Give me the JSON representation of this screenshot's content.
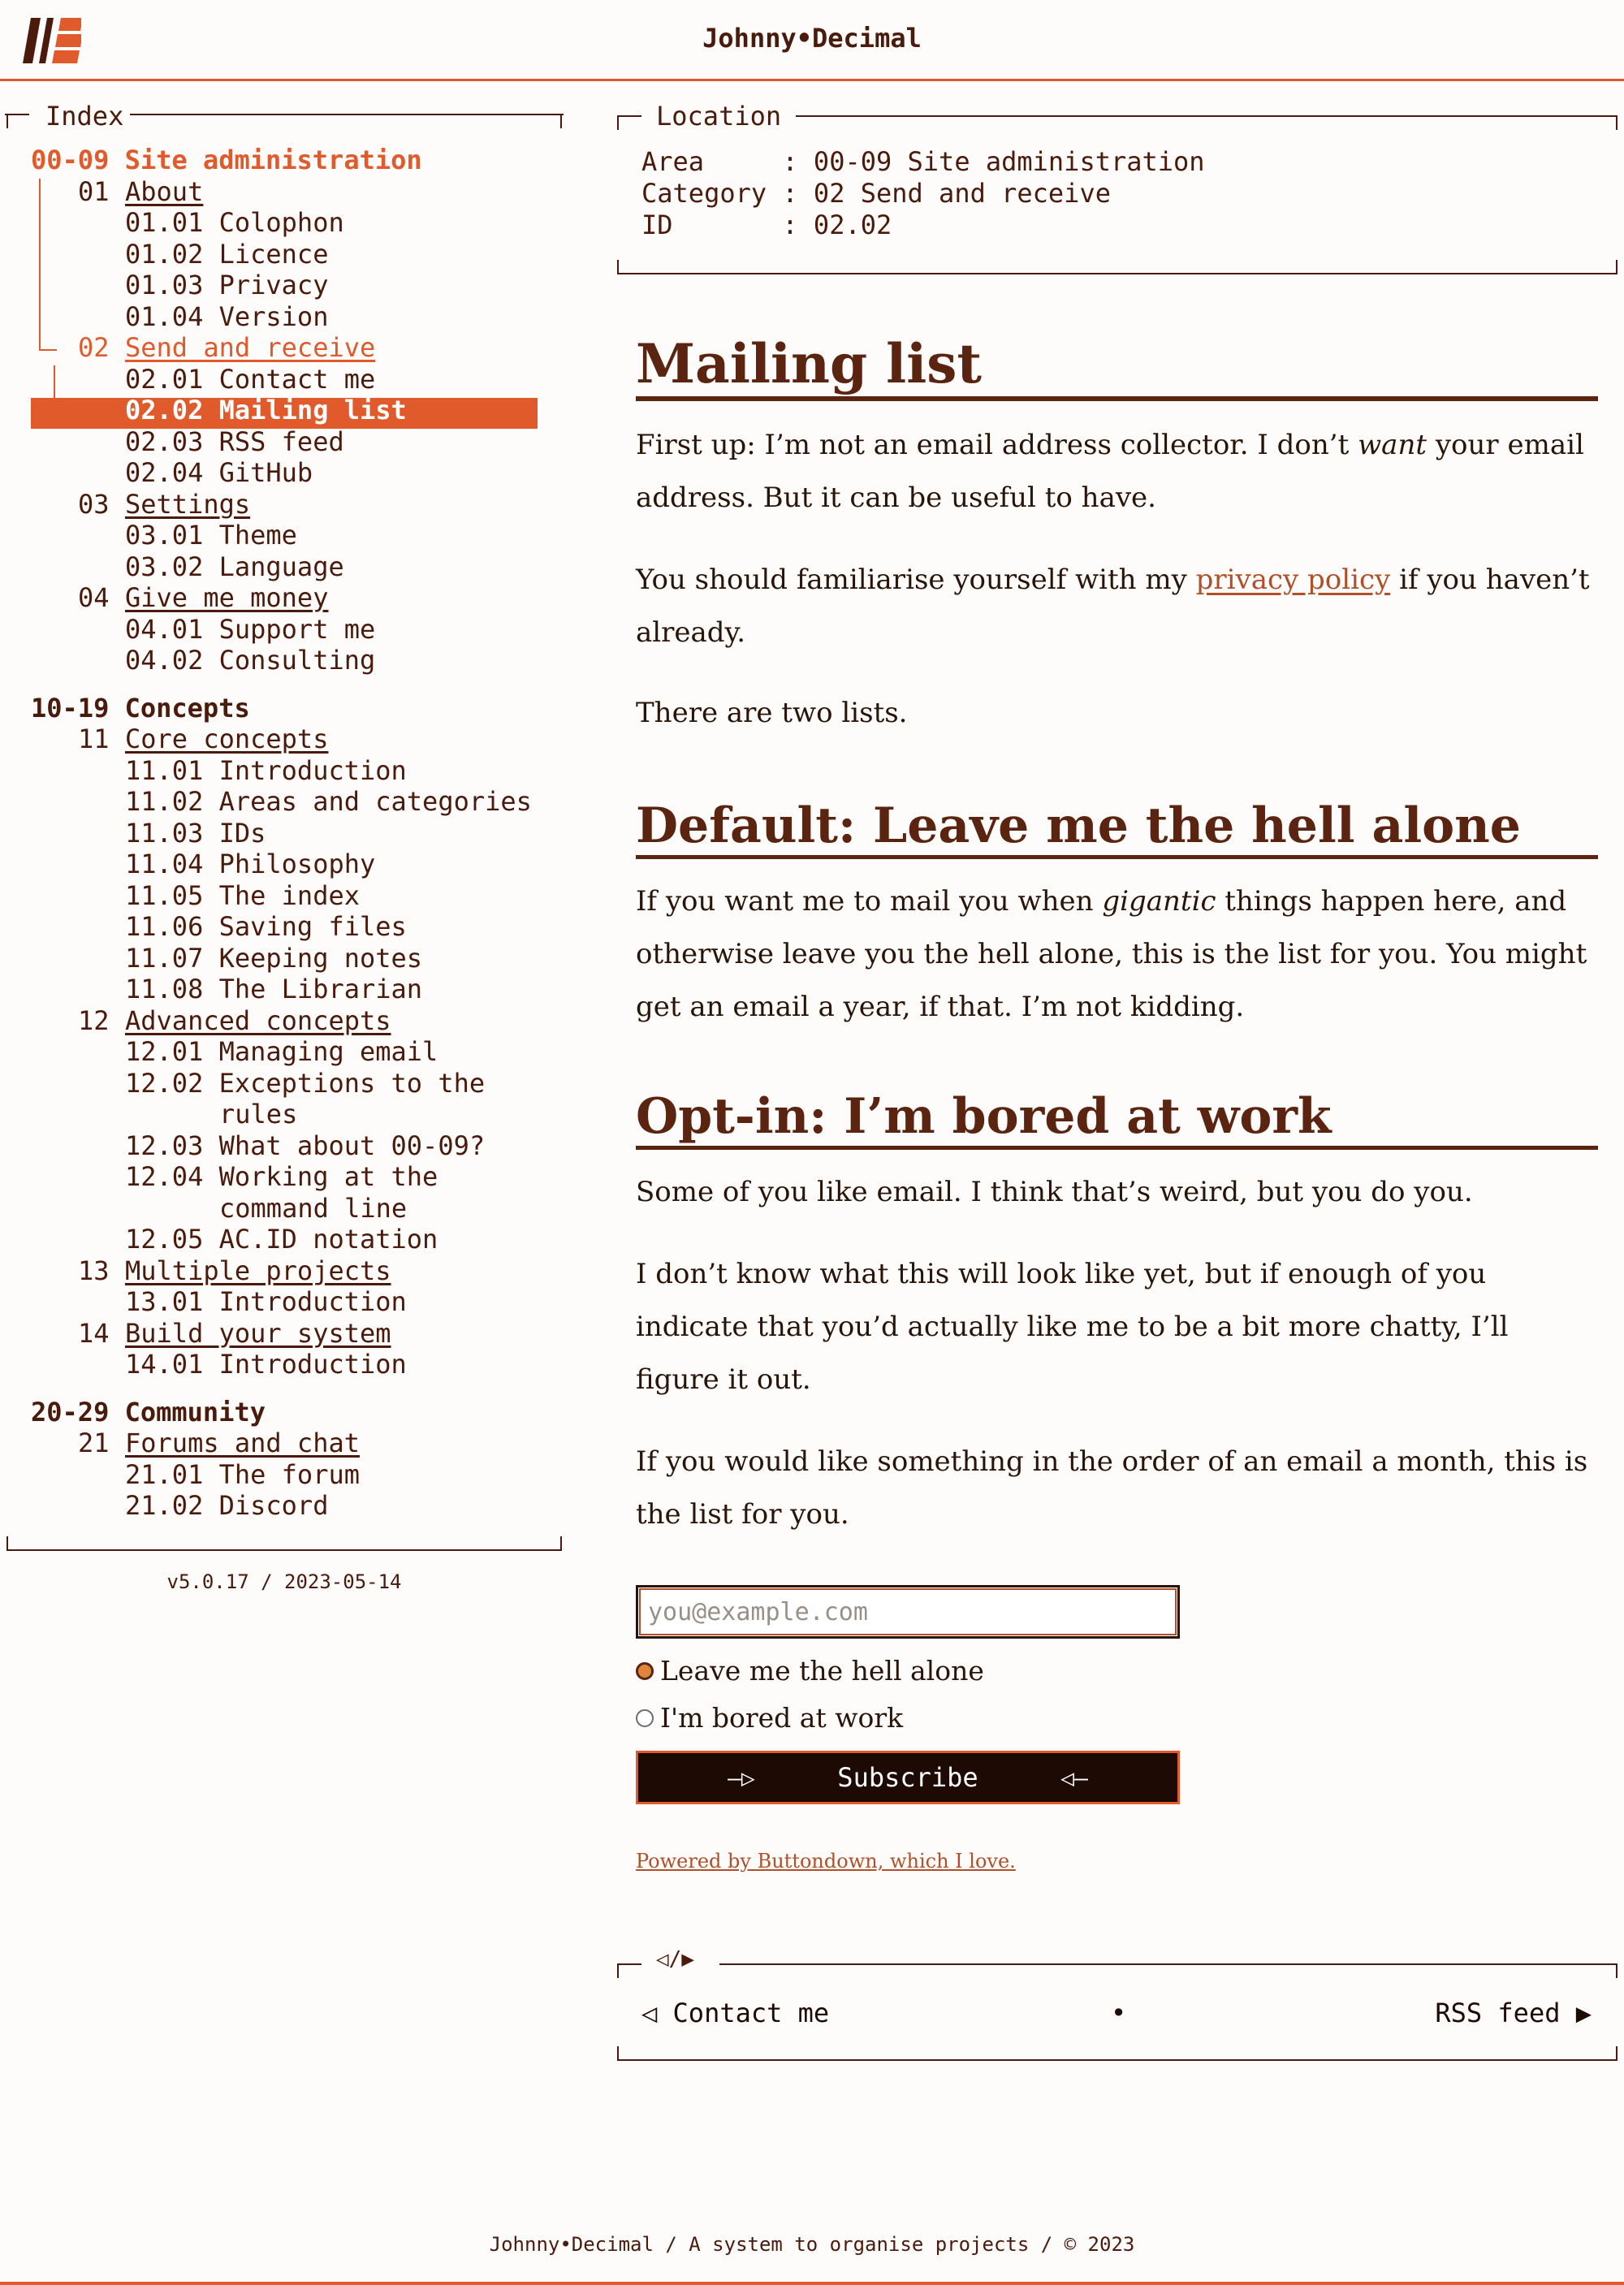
{
  "header": {
    "site_title": "Johnny•Decimal"
  },
  "index": {
    "legend": "Index",
    "rows": [
      {
        "type": "area",
        "num": "00-09",
        "label": "Site administration",
        "active": true
      },
      {
        "type": "cat",
        "num": "01",
        "label": "About"
      },
      {
        "type": "id",
        "text": "01.01 Colophon"
      },
      {
        "type": "id",
        "text": "01.02 Licence"
      },
      {
        "type": "id",
        "text": "01.03 Privacy"
      },
      {
        "type": "id",
        "text": "01.04 Version"
      },
      {
        "type": "cat",
        "num": "02",
        "label": "Send and receive",
        "active": true
      },
      {
        "type": "id",
        "text": "02.01 Contact me"
      },
      {
        "type": "id",
        "text": "02.02 Mailing list",
        "selected": true
      },
      {
        "type": "id",
        "text": "02.03 RSS feed"
      },
      {
        "type": "id",
        "text": "02.04 GitHub"
      },
      {
        "type": "cat",
        "num": "03",
        "label": "Settings"
      },
      {
        "type": "id",
        "text": "03.01 Theme"
      },
      {
        "type": "id",
        "text": "03.02 Language"
      },
      {
        "type": "cat",
        "num": "04",
        "label": "Give me money"
      },
      {
        "type": "id",
        "text": "04.01 Support me"
      },
      {
        "type": "id",
        "text": "04.02 Consulting"
      },
      {
        "type": "gap"
      },
      {
        "type": "area",
        "num": "10-19",
        "label": "Concepts"
      },
      {
        "type": "cat",
        "num": "11",
        "label": "Core concepts"
      },
      {
        "type": "id",
        "text": "11.01 Introduction"
      },
      {
        "type": "id",
        "text": "11.02 Areas and categories"
      },
      {
        "type": "id",
        "text": "11.03 IDs"
      },
      {
        "type": "id",
        "text": "11.04 Philosophy"
      },
      {
        "type": "id",
        "text": "11.05 The index"
      },
      {
        "type": "id",
        "text": "11.06 Saving files"
      },
      {
        "type": "id",
        "text": "11.07 Keeping notes"
      },
      {
        "type": "id",
        "text": "11.08 The Librarian"
      },
      {
        "type": "cat",
        "num": "12",
        "label": "Advanced concepts"
      },
      {
        "type": "id",
        "text": "12.01 Managing email"
      },
      {
        "type": "id",
        "text": "12.02 Exceptions to the"
      },
      {
        "type": "wrap",
        "text": "rules"
      },
      {
        "type": "id",
        "text": "12.03 What about 00-09?"
      },
      {
        "type": "id",
        "text": "12.04 Working at the"
      },
      {
        "type": "wrap",
        "text": "command line"
      },
      {
        "type": "id",
        "text": "12.05 AC.ID notation"
      },
      {
        "type": "cat",
        "num": "13",
        "label": "Multiple projects"
      },
      {
        "type": "id",
        "text": "13.01 Introduction"
      },
      {
        "type": "cat",
        "num": "14",
        "label": "Build your system"
      },
      {
        "type": "id",
        "text": "14.01 Introduction"
      },
      {
        "type": "gap"
      },
      {
        "type": "area",
        "num": "20-29",
        "label": "Community"
      },
      {
        "type": "cat",
        "num": "21",
        "label": "Forums and chat"
      },
      {
        "type": "id",
        "text": "21.01 The forum"
      },
      {
        "type": "id",
        "text": "21.02 Discord"
      }
    ],
    "version": "v5.0.17 / 2023-05-14"
  },
  "location": {
    "legend": "Location",
    "area": "Area     : 00-09 Site administration",
    "category": "Category : 02 Send and receive",
    "id": "ID       : 02.02"
  },
  "article": {
    "title": "Mailing list",
    "p1_a": "First up: I’m not an email address collector. I don’t ",
    "p1_em": "want",
    "p1_b": " your email address. But it can be useful to have.",
    "p2_a": "You should familiarise yourself with my ",
    "p2_link": "privacy policy",
    "p2_b": " if you haven’t already.",
    "p3": "There are two lists.",
    "h2_default": "Default: Leave me the hell alone",
    "p4_a": "If you want me to mail you when ",
    "p4_em": "gigantic",
    "p4_b": " things happen here, and otherwise leave you the hell alone, this is the list for you. You might get an email a year, if that. I’m not kidding.",
    "h2_optin": "Opt-in: I’m bored at work",
    "p5": "Some of you like email. I think that’s weird, but you do you.",
    "p6": "I don’t know what this will look like yet, but if enough of you indicate that you’d actually like me to be a bit more chatty, I’ll figure it out.",
    "p7": "If you would like something in the order of an email a month, this is the list for you."
  },
  "form": {
    "email_placeholder": "you@example.com",
    "radio_1": "Leave me the hell alone",
    "radio_2": "I'm bored at work",
    "radio_selected": "Leave me the hell alone",
    "subscribe_label": "Subscribe",
    "subscribe_left_arrow": "—▷",
    "subscribe_right_arrow": "◁—",
    "powered_by": "Powered by Buttondown, which I love."
  },
  "nav": {
    "legend": "◁/▶",
    "prev": "◁ Contact me",
    "separator": "•",
    "next": "RSS feed ▶"
  },
  "footer": {
    "text": "Johnny•Decimal / A system to organise projects / © 2023"
  },
  "colors": {
    "accent": "#e05a2b",
    "text": "#4a1a0c",
    "heading": "#5a2410",
    "background": "#fdfcfa"
  }
}
